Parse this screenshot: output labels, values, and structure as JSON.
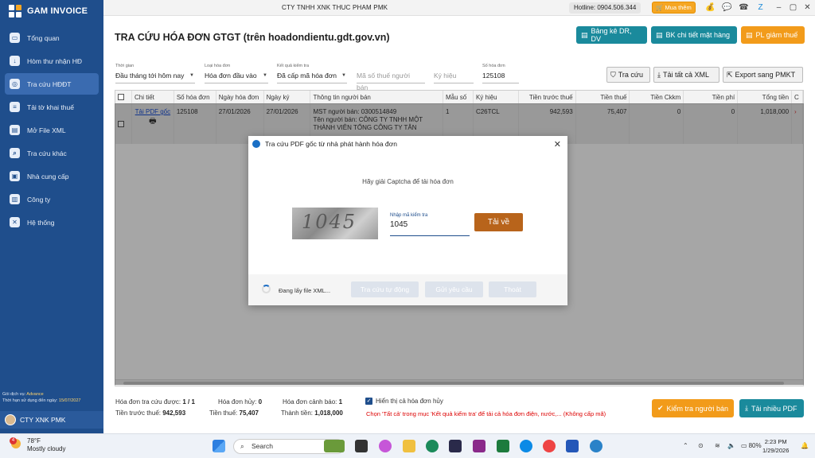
{
  "app": {
    "name": "GAM INVOICE",
    "company_header": "CTY TNHH XNK THUC PHAM PMK"
  },
  "topbar": {
    "hotline": "Hotline: 0904.506.344",
    "buy_label": "Mua thêm"
  },
  "sidebar": {
    "items": [
      {
        "label": "Tổng quan"
      },
      {
        "label": "Hòm thư nhận HĐ"
      },
      {
        "label": "Tra cứu HĐĐT"
      },
      {
        "label": "Tải tờ khai thuế"
      },
      {
        "label": "Mở File XML"
      },
      {
        "label": "Tra cứu khác"
      },
      {
        "label": "Nhà cung cấp"
      },
      {
        "label": "Công ty"
      },
      {
        "label": "Hệ thống"
      }
    ],
    "plan_label": "Gói dịch vụ:",
    "plan_value": "Advance",
    "expiry_label": "Thời hạn sử dụng đến ngày:",
    "expiry_value": "15/07/2027",
    "user": "CTY XNK PMK"
  },
  "header": {
    "title": "TRA CỨU HÓA ĐƠN GTGT (trên hoadondientu.gdt.gov.vn)",
    "btn_bangke": "Bảng kê DR, DV",
    "btn_bkchitiet": "BK chi tiết mặt hàng",
    "btn_plgiamthue": "PL giảm thuế"
  },
  "filters": {
    "time_label": "Thời gian",
    "time_value": "Đầu tháng tới hôm nay",
    "type_label": "Loại hóa đơn",
    "type_value": "Hóa đơn đầu vào",
    "result_label": "Kết quả kiểm tra",
    "result_value": "Đã cấp mã hóa đơn",
    "seller_tax_placeholder": "Mã số thuế người bán",
    "symbol_placeholder": "Ký hiệu",
    "invoice_no_label": "Số hóa đơn",
    "invoice_no_value": "125108"
  },
  "actions": {
    "search": "Tra cứu",
    "download_xml": "Tải tất cả XML",
    "export": "Export sang PMKT"
  },
  "table": {
    "columns": [
      "Chi tiết",
      "Số hóa đơn",
      "Ngày hóa đơn",
      "Ngày ký",
      "Thông tin người bán",
      "Mẫu số",
      "Ký hiệu",
      "Tiền trước thuế",
      "Tiền thuế",
      "Tiền Ckkm",
      "Tiền phí",
      "Tổng tiền",
      "C"
    ],
    "rows": [
      {
        "detail_link": "Tải PDF gốc",
        "invoice_no": "125108",
        "invoice_date": "27/01/2026",
        "sign_date": "27/01/2026",
        "seller_line1": "MST người bán: 0300514849",
        "seller_line2": "Tên người bán: CÔNG TY TNHH MỘT",
        "seller_line3": "THÀNH VIÊN TỔNG CÔNG TY TÂN",
        "form": "1",
        "symbol": "C26TCL",
        "pre_tax": "942,593",
        "tax": "75,407",
        "discount": "0",
        "fee": "0",
        "total": "1,018,000"
      }
    ]
  },
  "modal": {
    "title": "Tra cứu PDF gốc từ nhà phát hành hóa đơn",
    "instruction": "Hãy giải Captcha để tải hóa đơn",
    "captcha_text": "1045",
    "input_label": "Nhập mã kiểm tra",
    "input_value": "1045",
    "download_btn": "Tải về",
    "loading_text": "Đang lấy file XML...",
    "btn_auto": "Tra cứu tự động",
    "btn_send": "Gửi yêu cầu",
    "btn_exit": "Thoát"
  },
  "summary": {
    "found_label": "Hóa đơn tra cứu được:",
    "found_value": "1 / 1",
    "cancel_label": "Hóa đơn hủy:",
    "cancel_value": "0",
    "warn_label": "Hóa đơn cảnh báo:",
    "warn_value": "1",
    "show_cancel_label": "Hiển thị cả hóa đơn hủy",
    "pretax_label": "Tiền trước thuế:",
    "pretax_value": "942,593",
    "tax_label": "Tiền thuế:",
    "tax_value": "75,407",
    "total_label": "Thành tiền:",
    "total_value": "1,018,000",
    "warning_text": "Chọn 'Tất cả' trong mục 'Kết quả kiểm tra' để tải cả hóa đơn điện, nước,... (Không cấp mã)",
    "btn_check_seller": "Kiểm tra người bán",
    "btn_multi_pdf": "Tải nhiều PDF"
  },
  "taskbar": {
    "temp": "78°F",
    "weather": "Mostly cloudy",
    "weather_badge": "4",
    "search_placeholder": "Search",
    "battery": "80%",
    "time": "2:23 PM",
    "date": "1/29/2026"
  }
}
